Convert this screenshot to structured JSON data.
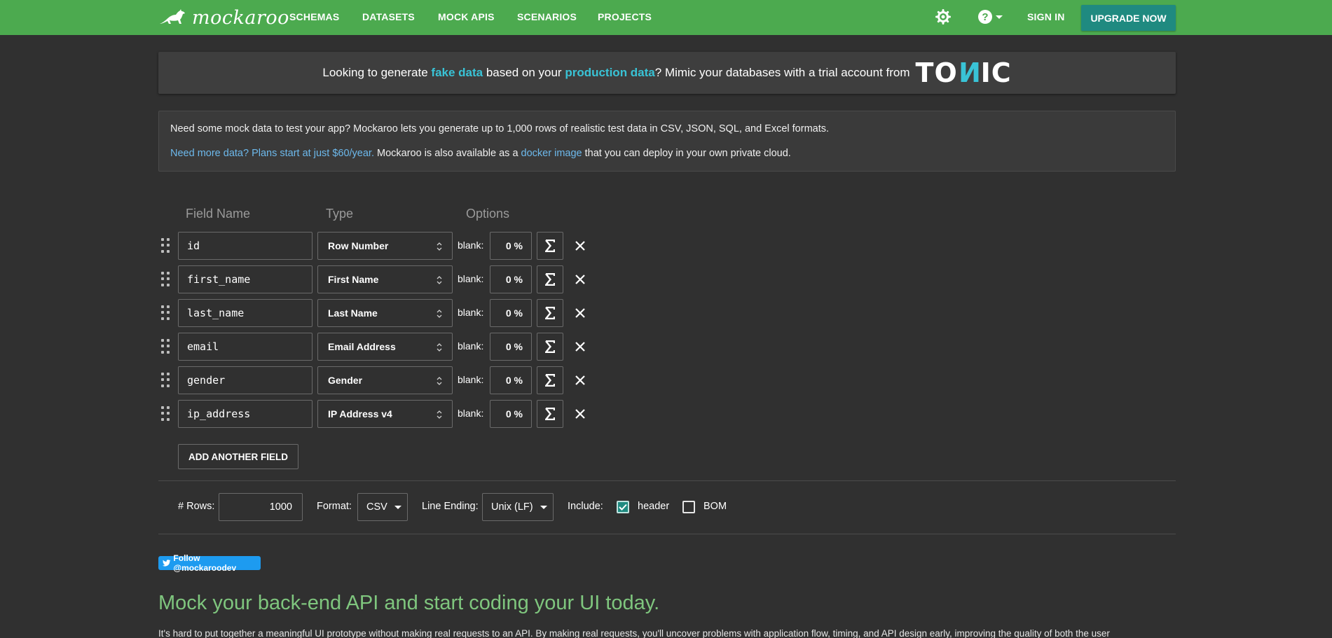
{
  "nav": {
    "logo_text": "mockaroo",
    "items": [
      "SCHEMAS",
      "DATASETS",
      "MOCK APIS",
      "SCENARIOS",
      "PROJECTS"
    ],
    "sign_in": "SIGN IN",
    "upgrade": "UPGRADE NOW",
    "icons": [
      "settings-gear-icon",
      "help-question-icon"
    ]
  },
  "banner": {
    "t1": "Looking to generate ",
    "hl1": "fake data",
    "t2": " based on your ",
    "hl2": "production data",
    "t3": "? Mimic your databases with a trial account from",
    "logo_a": "TO",
    "logo_n": "N",
    "logo_b": "IC"
  },
  "info": {
    "line1": "Need some mock data to test your app? Mockaroo lets you generate up to 1,000 rows of realistic test data in CSV, JSON, SQL, and Excel formats.",
    "link1": "Need more data? Plans start at just $60/year.",
    "t2": " Mockaroo is also available as a ",
    "link2": "docker image",
    "t3": " that you can deploy in your own private cloud."
  },
  "columns": {
    "field_name": "Field Name",
    "type": "Type",
    "options": "Options"
  },
  "fields": [
    {
      "name": "id",
      "type": "Row Number",
      "blank_label": "blank:",
      "blank": "0 %"
    },
    {
      "name": "first_name",
      "type": "First Name",
      "blank_label": "blank:",
      "blank": "0 %"
    },
    {
      "name": "last_name",
      "type": "Last Name",
      "blank_label": "blank:",
      "blank": "0 %"
    },
    {
      "name": "email",
      "type": "Email Address",
      "blank_label": "blank:",
      "blank": "0 %"
    },
    {
      "name": "gender",
      "type": "Gender",
      "blank_label": "blank:",
      "blank": "0 %"
    },
    {
      "name": "ip_address",
      "type": "IP Address v4",
      "blank_label": "blank:",
      "blank": "0 %"
    }
  ],
  "add_field": "ADD ANOTHER FIELD",
  "options": {
    "rows_label": "# Rows:",
    "rows_value": "1000",
    "format_label": "Format:",
    "format_value": "CSV",
    "line_ending_label": "Line Ending:",
    "line_ending_value": "Unix (LF)",
    "include_label": "Include:",
    "header_label": "header",
    "header_checked": true,
    "bom_label": "BOM",
    "bom_checked": false
  },
  "twitter": "Follow @mockaroodev",
  "headline": "Mock your back-end API and start coding your UI today.",
  "paragraph": "It's hard to put together a meaningful UI prototype without making real requests to an API. By making real requests, you'll uncover problems with application flow, timing, and API design early, improving the quality of both the user",
  "colors": {
    "topbar": "#4caa4f",
    "background": "#303030",
    "accent_teal": "#1f8a80",
    "highlight": "#39c3d6",
    "link": "#6db9ec",
    "headline": "#7fc67e"
  }
}
